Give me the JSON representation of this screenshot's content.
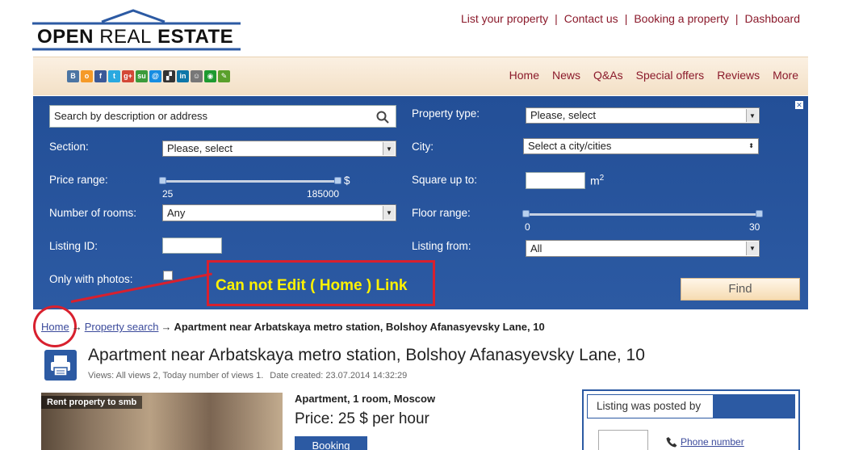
{
  "logo": {
    "word1": "OPEN",
    "word2": "REAL",
    "word3": "ESTATE"
  },
  "toplinks": [
    "List your property",
    "Contact us",
    "Booking a property",
    "Dashboard"
  ],
  "social": [
    {
      "icon": "vk-icon",
      "glyph": "B",
      "color": "#4c75a3"
    },
    {
      "icon": "odnoklassniki-icon",
      "glyph": "о",
      "color": "#f59a28"
    },
    {
      "icon": "facebook-icon",
      "glyph": "f",
      "color": "#3b5998"
    },
    {
      "icon": "twitter-icon",
      "glyph": "t",
      "color": "#2aa9e0"
    },
    {
      "icon": "google-plus-icon",
      "glyph": "g+",
      "color": "#d34836"
    },
    {
      "icon": "stumbleupon-icon",
      "glyph": "su",
      "color": "#3c9b3a"
    },
    {
      "icon": "moi-mir-icon",
      "glyph": "@",
      "color": "#168de2"
    },
    {
      "icon": "delicious-icon",
      "glyph": "▞",
      "color": "#333333"
    },
    {
      "icon": "linkedin-icon",
      "glyph": "in",
      "color": "#0e76a8"
    },
    {
      "icon": "blogger-icon",
      "glyph": "☺",
      "color": "#777777"
    },
    {
      "icon": "liveinternet-icon",
      "glyph": "◉",
      "color": "#1e9a30"
    },
    {
      "icon": "livejournal-icon",
      "glyph": "✎",
      "color": "#5aa02c"
    }
  ],
  "nav": [
    "Home",
    "News",
    "Q&As",
    "Special offers",
    "Reviews",
    "More"
  ],
  "search": {
    "placeholder": "Search by description or address",
    "property_type_label": "Property type:",
    "property_type_value": "Please, select",
    "section_label": "Section:",
    "section_value": "Please, select",
    "city_label": "City:",
    "city_value": "Select a city/cities",
    "price_label": "Price range:",
    "price_currency": "$",
    "price_min": "25",
    "price_max": "185000",
    "square_label": "Square up to:",
    "square_unit": "m",
    "square_sup": "2",
    "rooms_label": "Number of rooms:",
    "rooms_value": "Any",
    "floor_label": "Floor range:",
    "floor_min": "0",
    "floor_max": "30",
    "listing_id_label": "Listing ID:",
    "listing_from_label": "Listing from:",
    "listing_from_value": "All",
    "photos_label": "Only with photos:",
    "find_label": "Find",
    "close_glyph": "✕"
  },
  "annotation": "Can not Edit ( Home ) Link",
  "breadcrumb": {
    "home": "Home",
    "search": "Property search",
    "current": "Apartment near Arbatskaya metro station, Bolshoy Afanasyevsky Lane, 10",
    "arrow": "→"
  },
  "listing": {
    "title": "Apartment near Arbatskaya metro station, Bolshoy Afanasyevsky Lane, 10",
    "views": "Views: All views 2, Today number of views 1.",
    "created": "Date created: 23.07.2014 14:32:29",
    "photo_tag": "Rent property to smb",
    "type": "Apartment, 1 room, Moscow",
    "price": "Price: 25 $ per hour",
    "booking": "Booking",
    "posted_by": "Listing was posted by",
    "phone": "Phone number"
  }
}
